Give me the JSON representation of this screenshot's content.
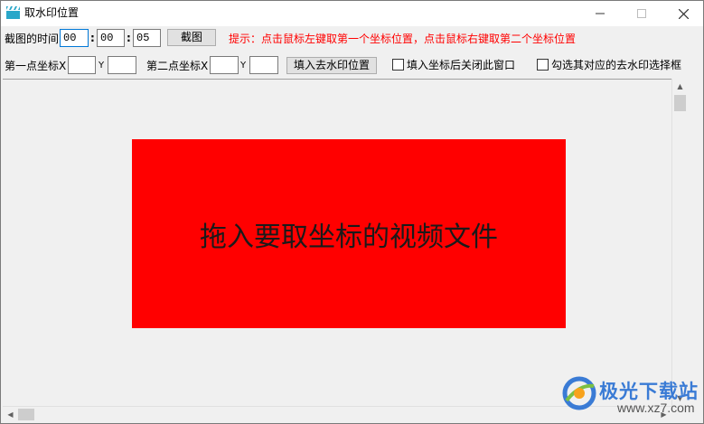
{
  "window": {
    "title": "取水印位置"
  },
  "colors": {
    "dropzone": "#ff0000",
    "hint": "#ff0000"
  },
  "row1": {
    "time_label": "截图的时间",
    "hours": "00",
    "minutes": "00",
    "seconds": "05",
    "sep": ":",
    "screenshot_button": "截图",
    "hint": "提示：点击鼠标左键取第一个坐标位置，点击鼠标右键取第二个坐标位置"
  },
  "row2": {
    "first_point_label": "第一点坐标X",
    "first_x": "",
    "y_label": "Y",
    "first_y": "",
    "second_point_label": "第二点坐标X",
    "second_x": "",
    "second_y": "",
    "fill_button": "填入去水印位置",
    "close_after_fill": "填入坐标后关闭此窗口",
    "check_box_option": "勾选其对应的去水印选择框"
  },
  "dropzone": {
    "text": "拖入要取坐标的视频文件"
  },
  "watermark": {
    "brand": "极光下载站",
    "url": "www.xz7.com"
  }
}
